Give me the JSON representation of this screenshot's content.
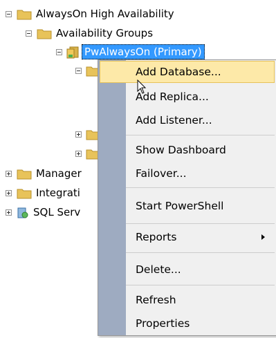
{
  "tree": {
    "root": {
      "label": "AlwaysOn High Availability"
    },
    "availability_groups": {
      "label": "Availability Groups"
    },
    "selected_group": {
      "label": "PwAlwaysOn (Primary)"
    },
    "management": {
      "label": "Manager"
    },
    "integration": {
      "label": "Integrati"
    },
    "sql_server": {
      "label": "SQL Serv"
    }
  },
  "context_menu": {
    "items": [
      {
        "label": "Add Database..."
      },
      {
        "label": "Add Replica..."
      },
      {
        "label": "Add Listener..."
      },
      {
        "label": "Show Dashboard"
      },
      {
        "label": "Failover..."
      },
      {
        "label": "Start PowerShell"
      },
      {
        "label": "Reports"
      },
      {
        "label": "Delete..."
      },
      {
        "label": "Refresh"
      },
      {
        "label": "Properties"
      }
    ]
  },
  "colors": {
    "folder": "#e8c35a",
    "selection": "#3399ff",
    "menu_hover": "#fde9a8",
    "menu_gutter": "#9eabc1"
  }
}
